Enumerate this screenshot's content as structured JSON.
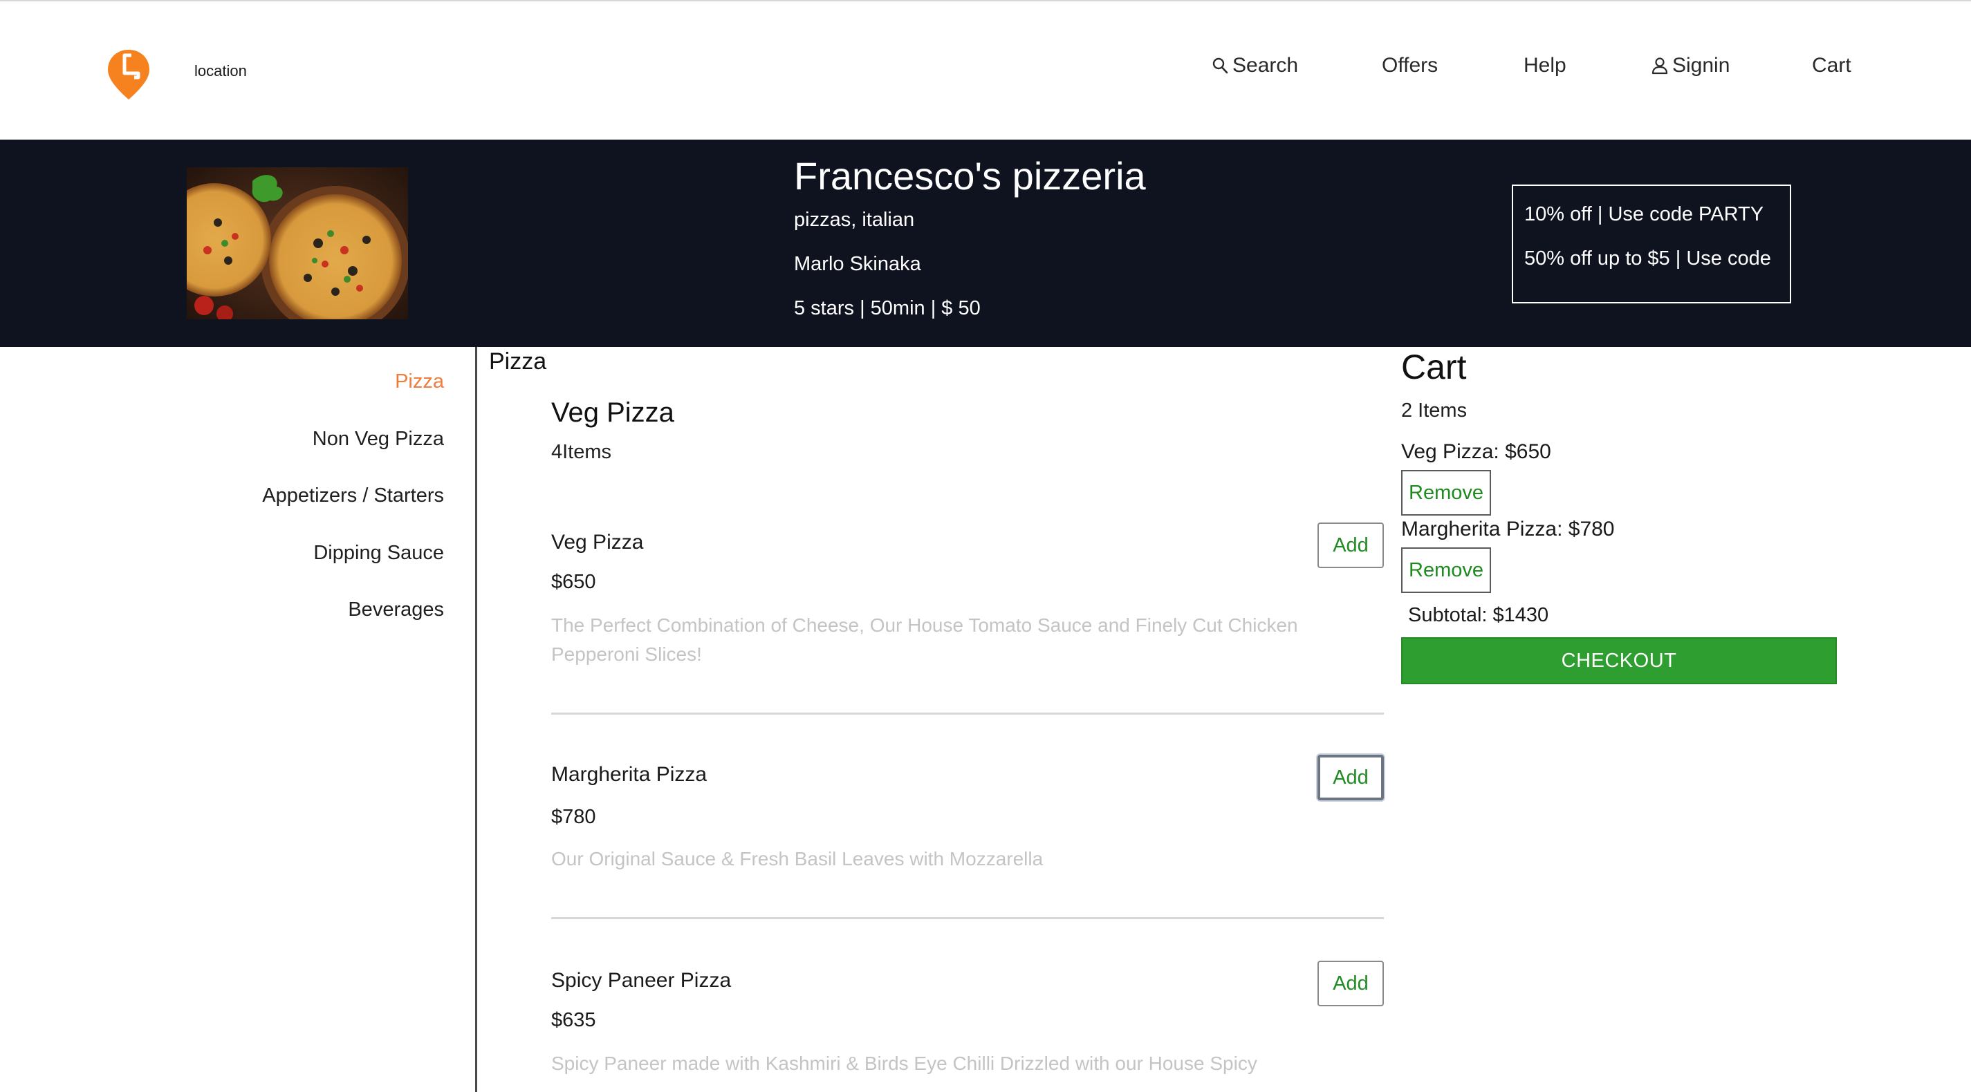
{
  "header": {
    "location_label": "location",
    "nav": {
      "search": "Search",
      "offers": "Offers",
      "help": "Help",
      "signin": "Signin",
      "cart": "Cart"
    },
    "brand_color": "#f5821f"
  },
  "restaurant": {
    "name": "Francesco's pizzeria",
    "cuisine": "pizzas, italian",
    "area": "Marlo Skinaka",
    "meta": "5 stars | 50min | $ 50",
    "offers": [
      "10% off | Use code PARTY",
      "50% off up to $5 | Use code"
    ]
  },
  "sidebar": {
    "items": [
      {
        "label": "Pizza",
        "active": true
      },
      {
        "label": "Non Veg Pizza",
        "active": false
      },
      {
        "label": "Appetizers / Starters",
        "active": false
      },
      {
        "label": "Dipping Sauce",
        "active": false
      },
      {
        "label": "Beverages",
        "active": false
      }
    ],
    "active_color": "#f07c3e"
  },
  "menu": {
    "section_title": "Pizza",
    "category_title": "Veg Pizza",
    "category_count": "4Items",
    "add_label": "Add",
    "items": [
      {
        "name": "Veg Pizza",
        "price": "$650",
        "description": "The Perfect Combination of Cheese, Our House Tomato Sauce and Finely Cut Chicken Pepperoni Slices!"
      },
      {
        "name": "Margherita Pizza",
        "price": "$780",
        "description": "Our Original Sauce & Fresh Basil Leaves with Mozzarella"
      },
      {
        "name": "Spicy Paneer Pizza",
        "price": "$635",
        "description": "Spicy Paneer made with Kashmiri & Birds Eye Chilli Drizzled with our House Spicy Mayonnaise!"
      }
    ]
  },
  "cart": {
    "title": "Cart",
    "count": "2 Items",
    "lines": [
      "Veg Pizza: $650",
      "Margherita Pizza: $780"
    ],
    "remove_label": "Remove",
    "subtotal": "Subtotal: $1430",
    "checkout_label": "CHECKOUT",
    "checkout_color": "#2f9e31"
  }
}
